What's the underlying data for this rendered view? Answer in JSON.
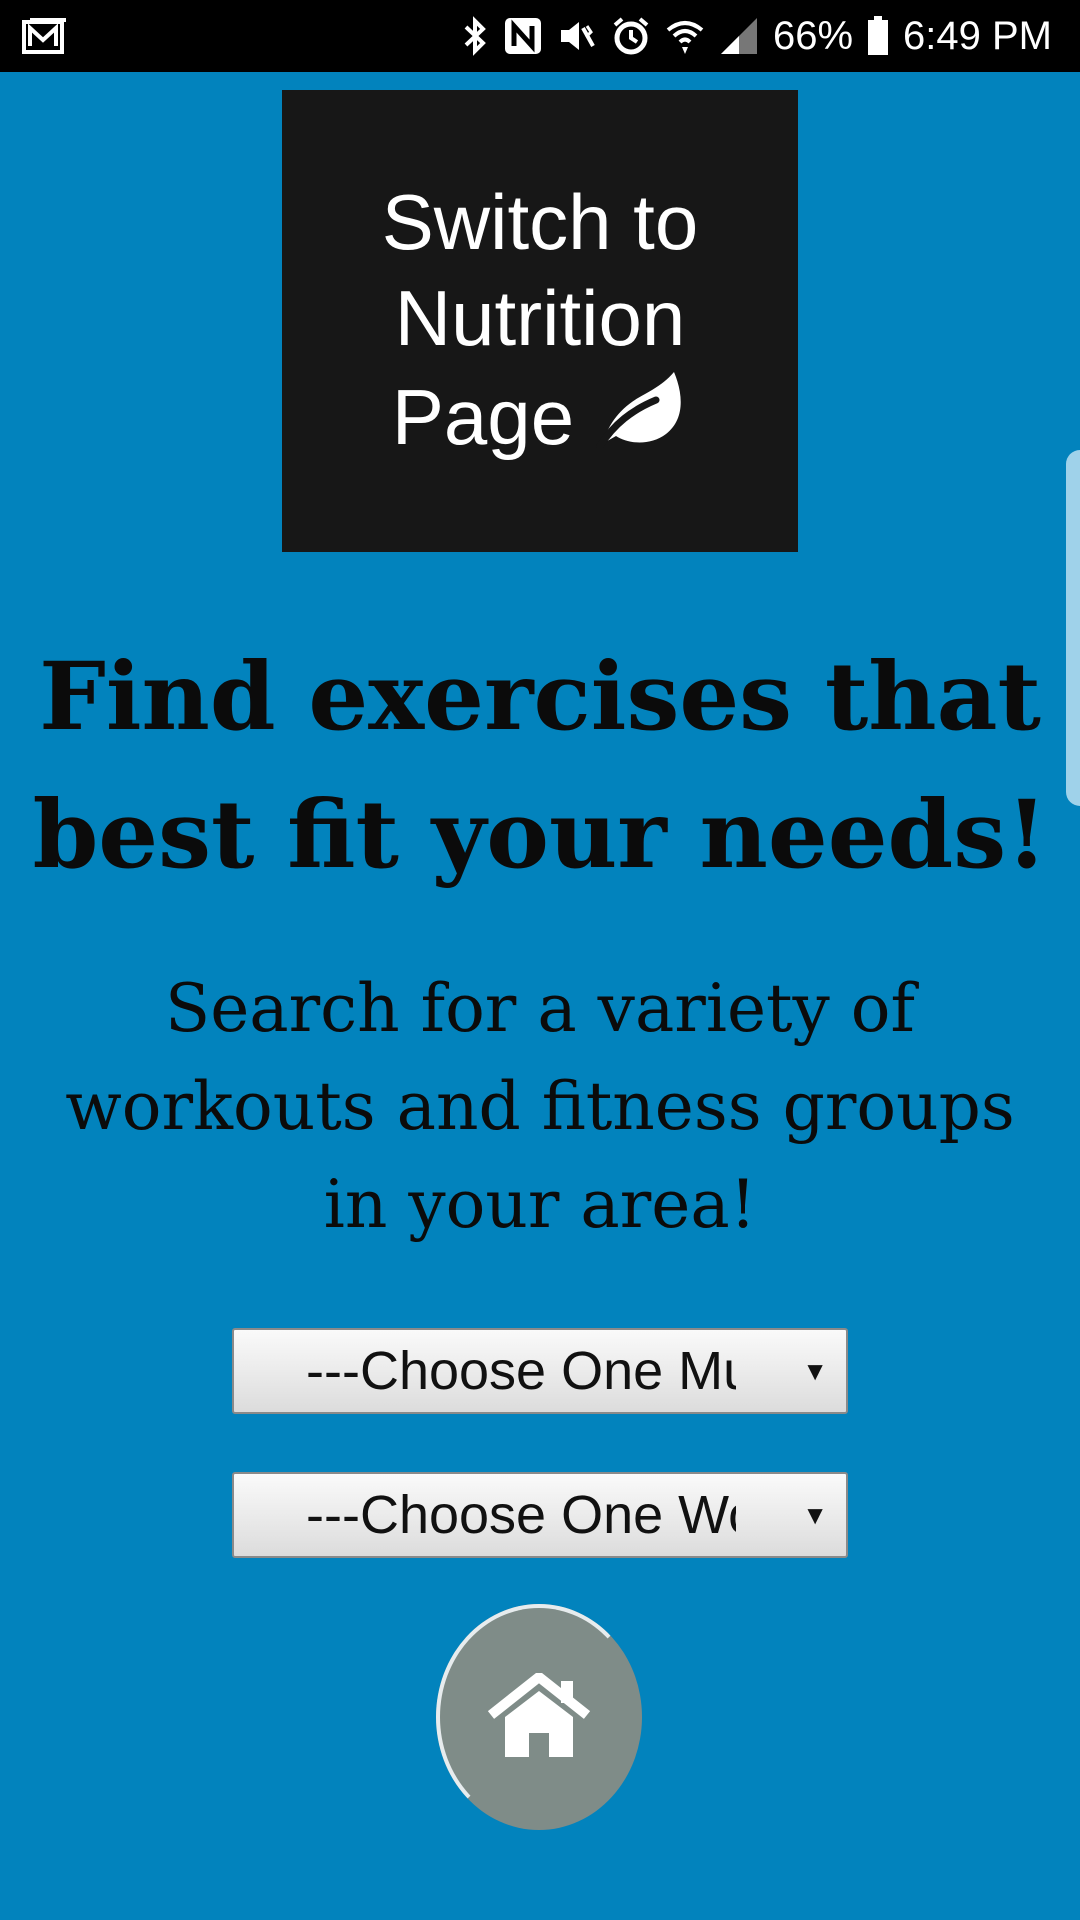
{
  "status_bar": {
    "battery": "66%",
    "time": "6:49 PM",
    "icons": [
      "gmail-icon",
      "bluetooth-icon",
      "nfc-icon",
      "vibrate-icon",
      "alarm-icon",
      "wifi-icon",
      "signal-icon",
      "battery-icon"
    ]
  },
  "switch_button": {
    "line1": "Switch to",
    "line2": "Nutrition",
    "line3": "Page",
    "icon": "leaf-icon"
  },
  "headline": {
    "line1": "Find exercises that",
    "line2": "best fit your needs!"
  },
  "subtext": {
    "line1": "Search for a variety of",
    "line2": "workouts and fitness groups",
    "line3": "in your area!"
  },
  "selects": {
    "muscle": {
      "value": "---Choose One Mu"
    },
    "workout": {
      "value": "---Choose One Wo"
    }
  },
  "home_button": {
    "icon": "home-icon"
  },
  "colors": {
    "background": "#0283bd",
    "button_dark": "#171717",
    "home_button": "#7f8c88"
  }
}
